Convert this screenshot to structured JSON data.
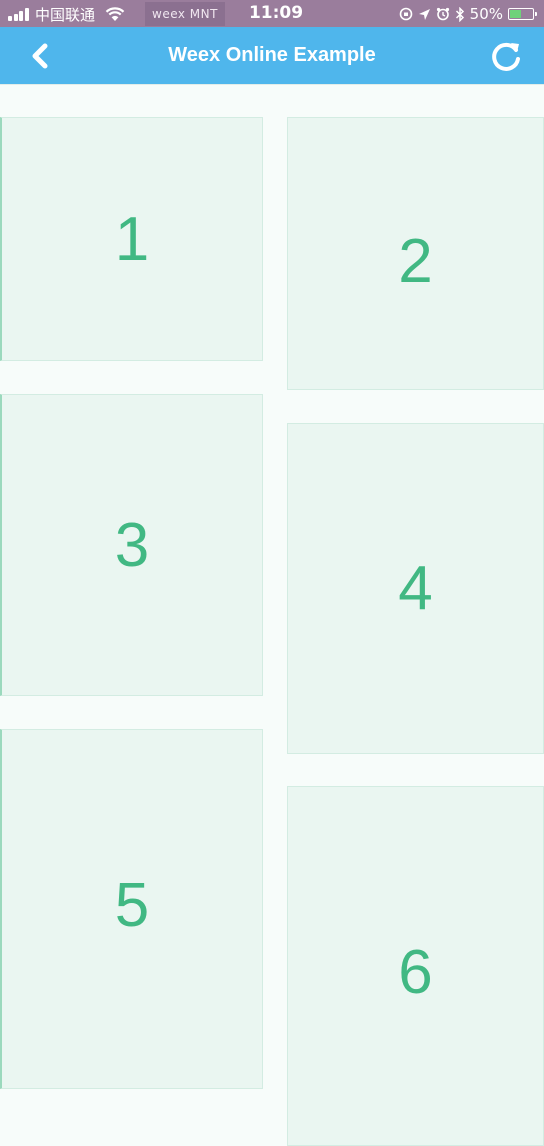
{
  "status_bar": {
    "carrier": "中国联通",
    "app_badge": "weex MNT",
    "time": "11:09",
    "battery_percent": "50%",
    "battery_level": 0.5
  },
  "nav": {
    "title": "Weex Online Example",
    "back_icon": "chevron-left-icon",
    "refresh_icon": "refresh-icon"
  },
  "cells": [
    {
      "label": "1",
      "column": "left"
    },
    {
      "label": "2",
      "column": "right"
    },
    {
      "label": "3",
      "column": "left"
    },
    {
      "label": "4",
      "column": "right"
    },
    {
      "label": "5",
      "column": "left"
    },
    {
      "label": "6",
      "column": "right"
    }
  ],
  "colors": {
    "nav_background": "#4fb6ec",
    "cell_background": "#eaf6f1",
    "cell_text": "#41b883",
    "page_background": "#f7fcfa"
  }
}
